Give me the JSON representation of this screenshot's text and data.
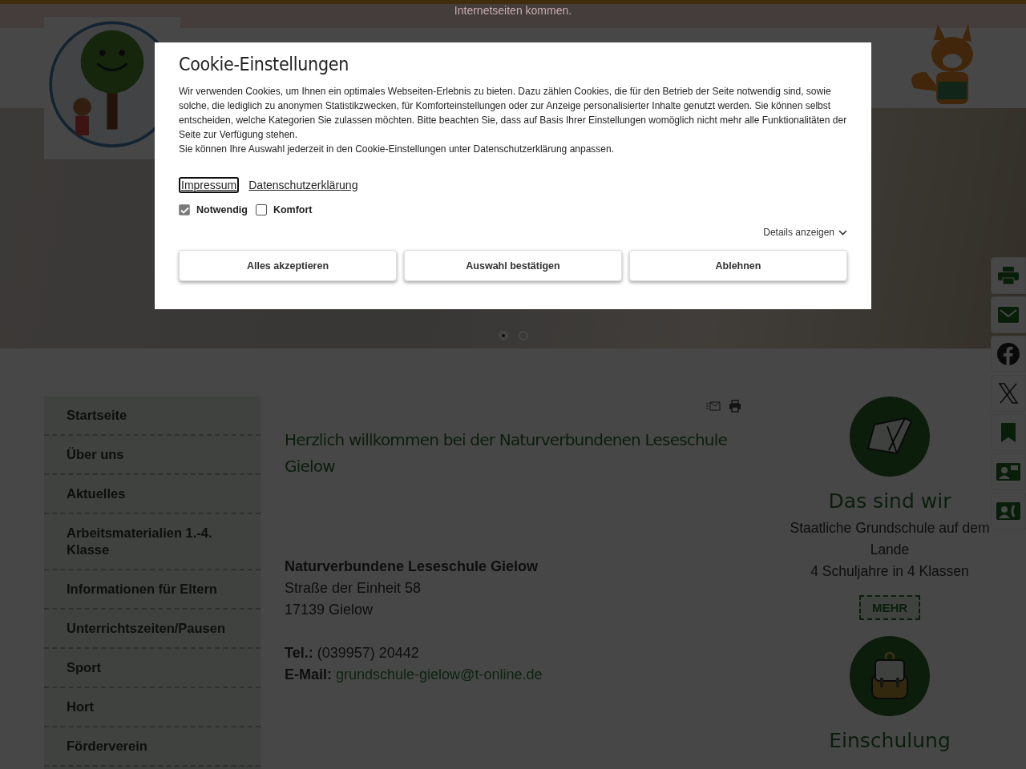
{
  "notice_bar": {
    "text": "Internetseiten kommen."
  },
  "hero": {
    "slides": [
      {
        "selected": true
      },
      {
        "selected": false
      }
    ]
  },
  "cookie_dialog": {
    "title": "Cookie-Einstellungen",
    "paragraphs": [
      "Wir verwenden Cookies, um Ihnen ein optimales Webseiten-Erlebnis zu bieten. Dazu zählen Cookies, die für den Betrieb der Seite notwendig sind, sowie solche, die lediglich zu anonymen Statistikzwecken, für Komforteinstellungen oder zur Anzeige personalisierter Inhalte genutzt werden. Sie können selbst entscheiden, welche Kategorien Sie zulassen möchten. Bitte beachten Sie, dass auf Basis Ihrer Einstellungen womöglich nicht mehr alle Funktionalitäten der Seite zur Verfügung stehen.",
      "Sie können Ihre Auswahl jederzeit in den Cookie-Einstellungen unter Datenschutzerklärung anpassen."
    ],
    "links": [
      {
        "label": "Impressum",
        "focused": true
      },
      {
        "label": "Datenschutzerklärung",
        "focused": false
      }
    ],
    "categories": [
      {
        "label": "Notwendig",
        "checked": true,
        "disabled": true
      },
      {
        "label": "Komfort",
        "checked": false,
        "disabled": false
      }
    ],
    "details_toggle": "Details anzeigen",
    "buttons": [
      "Alles akzeptieren",
      "Auswahl bestätigen",
      "Ablehnen"
    ]
  },
  "sidebar_nav": {
    "items": [
      {
        "label": "Startseite"
      },
      {
        "label": "Über uns"
      },
      {
        "label": "Aktuelles"
      },
      {
        "label": "Arbeitsmaterialien 1.-4. Klasse"
      },
      {
        "label": "Informationen für Eltern"
      },
      {
        "label": "Unterrichtszeiten/Pausen"
      },
      {
        "label": "Sport"
      },
      {
        "label": "Hort"
      },
      {
        "label": "Förderverein"
      }
    ]
  },
  "article": {
    "heading": "Herzlich willkommen bei der Naturverbundenen Leseschule Gielow",
    "school_name": "Naturverbundene Leseschule Gielow",
    "street": "Straße der Einheit 58",
    "city": "17139 Gielow",
    "phone": {
      "label": "Tel.:",
      "value": "(039957) 20442"
    },
    "email": {
      "label": "E-Mail:",
      "value": "grundschule-gielow@t-online.de"
    }
  },
  "teasers": [
    {
      "kind": "book",
      "title": "Das sind wir",
      "lines": [
        "Staatliche Grundschule auf dem Lande",
        "4 Schuljahre in 4 Klassen"
      ],
      "button": "MEHR"
    },
    {
      "kind": "backpack",
      "title": "Einschulung"
    }
  ]
}
